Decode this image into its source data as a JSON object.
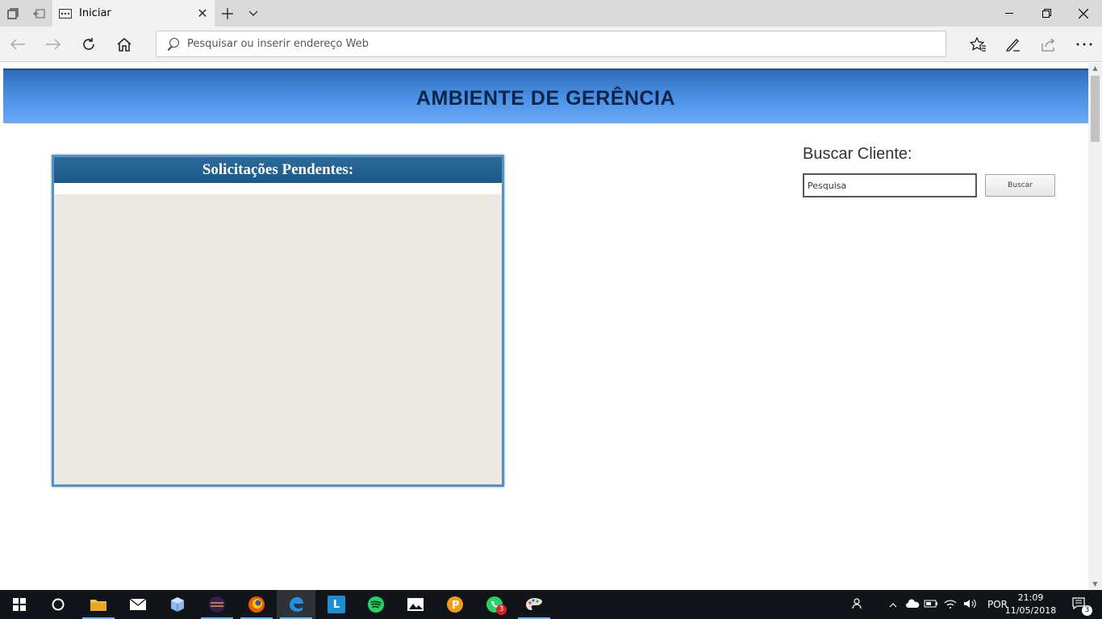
{
  "browser": {
    "tab": {
      "title": "Iniciar"
    },
    "address_bar": {
      "placeholder": "Pesquisar ou inserir endereço Web"
    }
  },
  "page": {
    "header_title": "AMBIENTE DE GERÊNCIA",
    "pending_panel": {
      "title": "Solicitações Pendentes:"
    },
    "search": {
      "label": "Buscar Cliente:",
      "input_placeholder": "Pesquisa",
      "button_label": "Buscar"
    }
  },
  "taskbar": {
    "whatsapp_badge": "3",
    "language": "POR",
    "time": "21:09",
    "date": "11/05/2018",
    "notification_count": "3"
  },
  "colors": {
    "header_blue": "#4d92e8",
    "panel_head": "#195a89",
    "taskbar": "#111418"
  }
}
